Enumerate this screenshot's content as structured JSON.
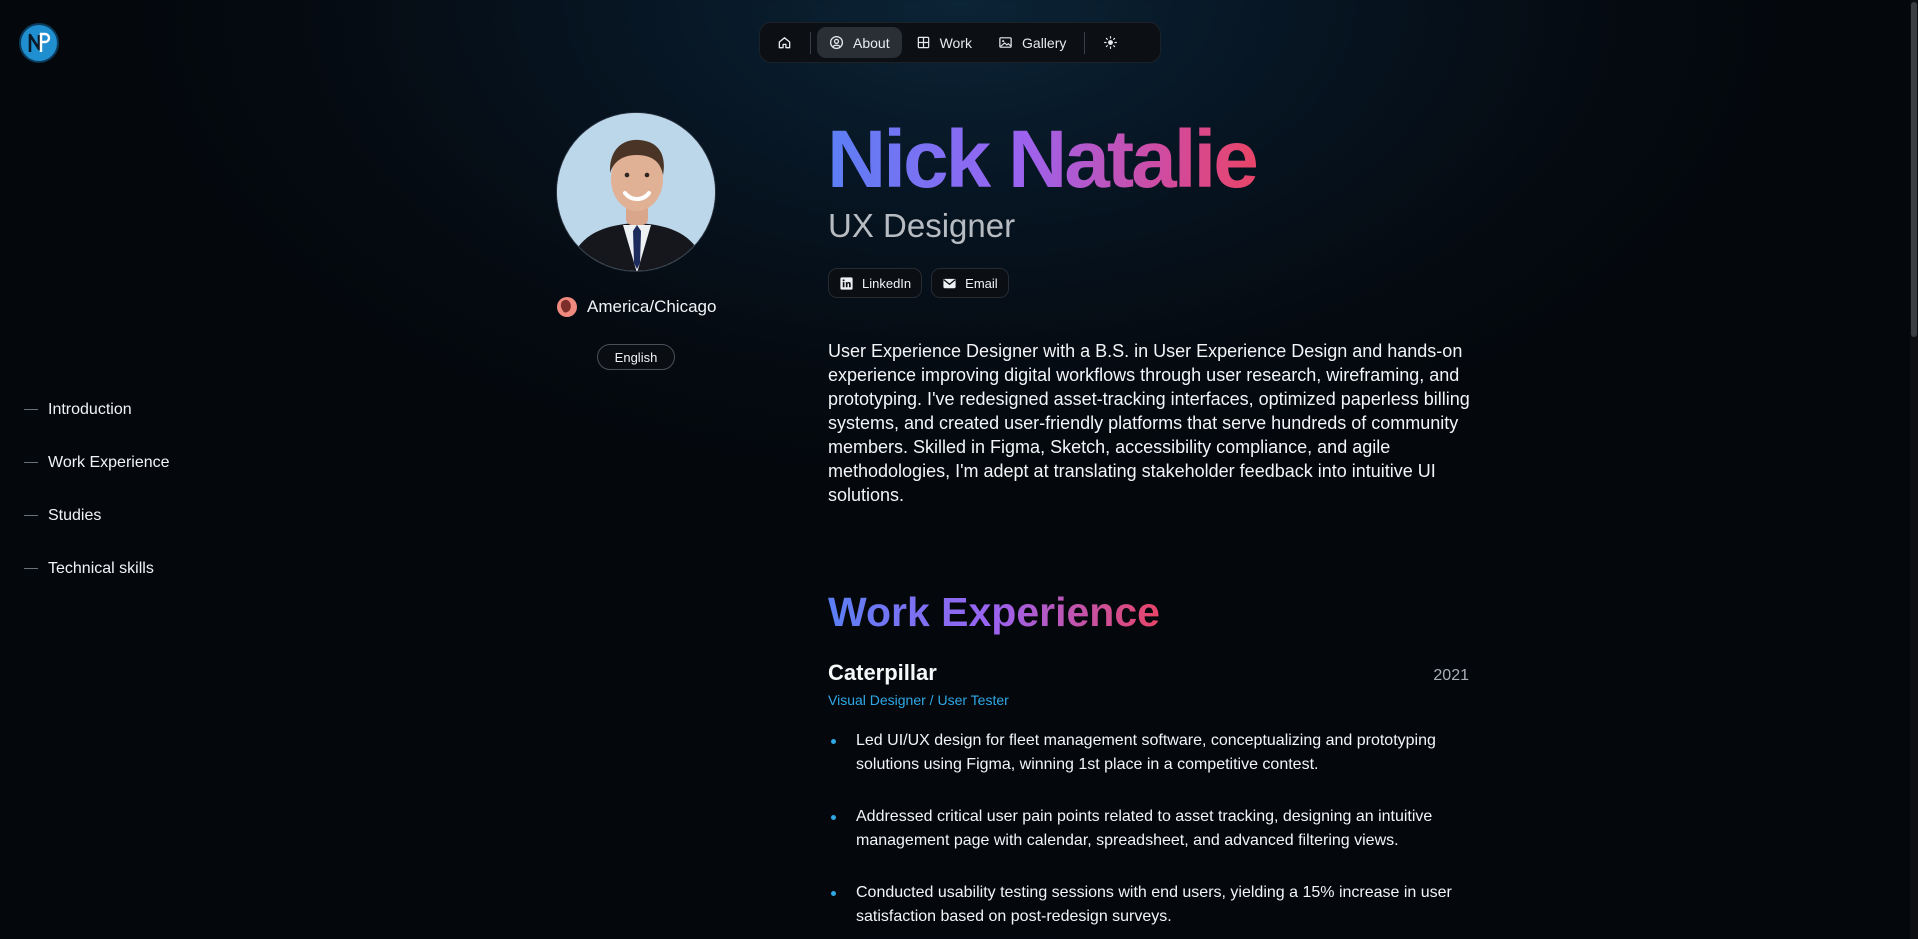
{
  "nav": {
    "items": [
      {
        "label": "",
        "icon": "home-icon"
      },
      {
        "label": "About",
        "icon": "user-circle-icon"
      },
      {
        "label": "Work",
        "icon": "grid-icon"
      },
      {
        "label": "Gallery",
        "icon": "image-icon"
      }
    ],
    "theme_icon": "sun-icon"
  },
  "profile": {
    "location": "America/Chicago",
    "language": "English"
  },
  "toc": [
    "Introduction",
    "Work Experience",
    "Studies",
    "Technical skills"
  ],
  "hero": {
    "name": "Nick Natalie",
    "role": "UX Designer",
    "social": [
      {
        "label": "LinkedIn",
        "icon": "linkedin-icon"
      },
      {
        "label": "Email",
        "icon": "email-icon"
      }
    ],
    "bio": "User Experience Designer with a B.S. in User Experience Design and hands-on experience improving digital workflows through user research, wireframing, and prototyping. I've redesigned asset-tracking interfaces, optimized paperless billing systems, and created user-friendly platforms that serve hundreds of community members. Skilled in Figma, Sketch, accessibility compliance, and agile methodologies, I'm adept at translating stakeholder feedback into intuitive UI solutions."
  },
  "work": {
    "section_title": "Work Experience",
    "jobs": [
      {
        "company": "Caterpillar",
        "year": "2021",
        "title": "Visual Designer / User Tester",
        "bullets": [
          "Led UI/UX design for fleet management software, conceptualizing and prototyping solutions using Figma, winning 1st place in a competitive contest.",
          "Addressed critical user pain points related to asset tracking, designing an intuitive management page with calendar, spreadsheet, and advanced filtering views.",
          "Conducted usability testing sessions with end users, yielding a 15% increase in user satisfaction based on post-redesign surveys."
        ]
      }
    ]
  },
  "colors": {
    "accent": "#2fa8e6",
    "gradient_start": "#5b7ff5",
    "gradient_mid": "#9b63f0",
    "gradient_end": "#e84568"
  }
}
